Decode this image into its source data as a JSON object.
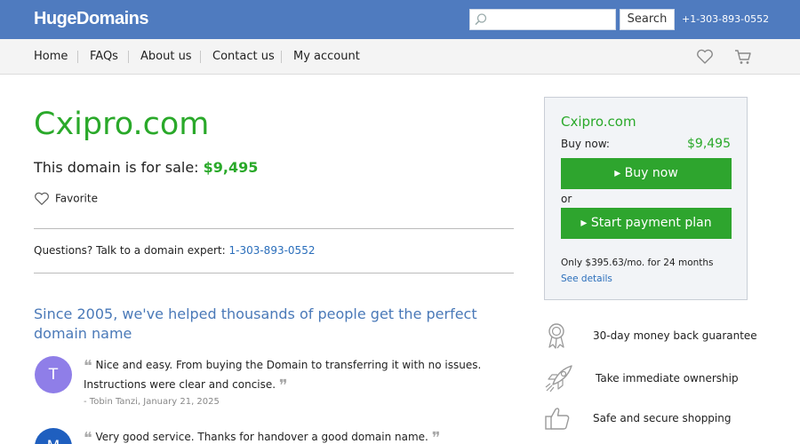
{
  "header": {
    "logo": "HugeDomains",
    "search_placeholder": "",
    "search_button": "Search",
    "phone": "+1-303-893-0552",
    "icons": [
      "search-icon",
      "heart-icon",
      "cart-icon"
    ]
  },
  "nav": {
    "items": [
      "Home",
      "FAQs",
      "About us",
      "Contact us",
      "My account"
    ]
  },
  "main": {
    "domain": "Cxipro.com",
    "sale_text": "This domain is for sale:",
    "sale_price": "$9,495",
    "favorite": "Favorite",
    "questions_text": "Questions? Talk to a domain expert:",
    "questions_phone": "1-303-893-0552",
    "since_heading": "Since 2005, we've helped thousands of people get the perfect domain name",
    "reviews": [
      {
        "initial": "T",
        "text": "Nice and easy. From buying the Domain to transferring it with no issues. Instructions were clear and concise.",
        "author": "- Tobin Tanzi, January 21, 2025",
        "color": "#8f7ee8"
      },
      {
        "initial": "M",
        "text": "Very good service. Thanks for handover a good domain name.",
        "author": "",
        "color": "#1f5fbf"
      }
    ]
  },
  "sidebar": {
    "domain": "Cxipro.com",
    "buy_label": "Buy now:",
    "price": "$9,495",
    "buy_button": "▸ Buy now",
    "or": "or",
    "plan_button": "▸ Start payment plan",
    "plan_text": "Only $395.63/mo. for 24 months",
    "see_details": "See details"
  },
  "features": [
    {
      "icon": "award-ribbon-icon",
      "text": "30-day money back guarantee"
    },
    {
      "icon": "rocket-icon",
      "text": "Take immediate ownership"
    },
    {
      "icon": "thumbs-up-icon",
      "text": "Safe and secure shopping"
    }
  ],
  "colors": {
    "header_blue": "#4f7bbf",
    "green": "#2aa92a",
    "link_blue": "#2a6ebb",
    "heading_blue": "#4a79b8"
  }
}
